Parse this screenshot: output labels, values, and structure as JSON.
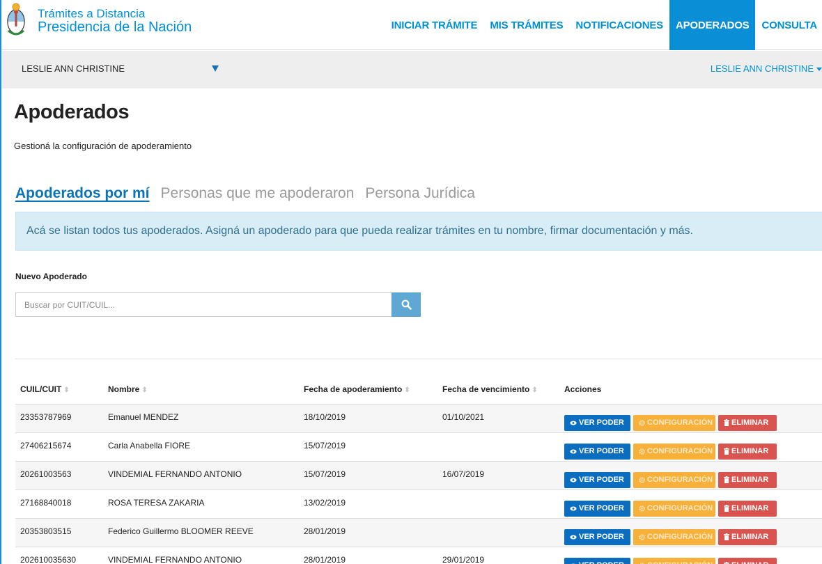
{
  "header": {
    "brand_line1": "Trámites a Distancia",
    "brand_line2": "Presidencia de la Nación",
    "nav": [
      {
        "label": "INICIAR TRÁMITE",
        "active": false
      },
      {
        "label": "MIS TRÁMITES",
        "active": false
      },
      {
        "label": "NOTIFICACIONES",
        "active": false
      },
      {
        "label": "APODERADOS",
        "active": true
      },
      {
        "label": "CONSULTA",
        "active": false
      }
    ]
  },
  "userbar": {
    "selected_user": "LESLIE ANN CHRISTINE",
    "account_menu": "LESLIE ANN CHRISTINE"
  },
  "page": {
    "title": "Apoderados",
    "subtitle": "Gestioná la configuración de apoderamiento"
  },
  "tabs": [
    {
      "label": "Apoderados por mí",
      "active": true
    },
    {
      "label": "Personas que me apoderaron",
      "active": false
    },
    {
      "label": "Persona Jurídica",
      "active": false
    }
  ],
  "alert": {
    "text": "Acá se listan todos tus apoderados. Asigná un apoderado para que pueda realizar trámites en tu nombre, firmar documentación y más."
  },
  "search": {
    "label": "Nuevo Apoderado",
    "placeholder": "Buscar por CUIT/CUIL...",
    "value": "",
    "icon": "search-icon"
  },
  "table": {
    "headers": {
      "cuil": "CUIL/CUIT",
      "nombre": "Nombre",
      "fecha_apoderamiento": "Fecha de apoderamiento",
      "fecha_vencimiento": "Fecha de vencimiento",
      "acciones": "Acciones"
    },
    "actions": {
      "view": "VER PODER",
      "config": "CONFIGURACIÓN",
      "delete": "ELIMINAR"
    },
    "rows": [
      {
        "cuil": "23353787969",
        "nombre": "Emanuel MENDEZ",
        "fecha_apoderamiento": "18/10/2019",
        "fecha_vencimiento": "01/10/2021"
      },
      {
        "cuil": "27406215674",
        "nombre": "Carla Anabella FIORE",
        "fecha_apoderamiento": "15/07/2019",
        "fecha_vencimiento": ""
      },
      {
        "cuil": "20261003563",
        "nombre": "VINDEMIAL FERNANDO ANTONIO",
        "fecha_apoderamiento": "15/07/2019",
        "fecha_vencimiento": "16/07/2019"
      },
      {
        "cuil": "27168840018",
        "nombre": "ROSA TERESA ZAKARIA",
        "fecha_apoderamiento": "13/02/2019",
        "fecha_vencimiento": ""
      },
      {
        "cuil": "20353803515",
        "nombre": "Federico Guillermo BLOOMER REEVE",
        "fecha_apoderamiento": "28/01/2019",
        "fecha_vencimiento": ""
      },
      {
        "cuil": "202610035630",
        "nombre": "VINDEMIAL FERNANDO ANTONIO",
        "fecha_apoderamiento": "28/01/2019",
        "fecha_vencimiento": "29/01/2019"
      }
    ]
  },
  "colors": {
    "brand": "#0090d6",
    "nav_active_bg": "#0a8ed6",
    "alert_bg": "#d9edf7",
    "btn_view": "#0a6dc0",
    "btn_config": "#f7b13a",
    "btn_delete": "#d9534f"
  }
}
